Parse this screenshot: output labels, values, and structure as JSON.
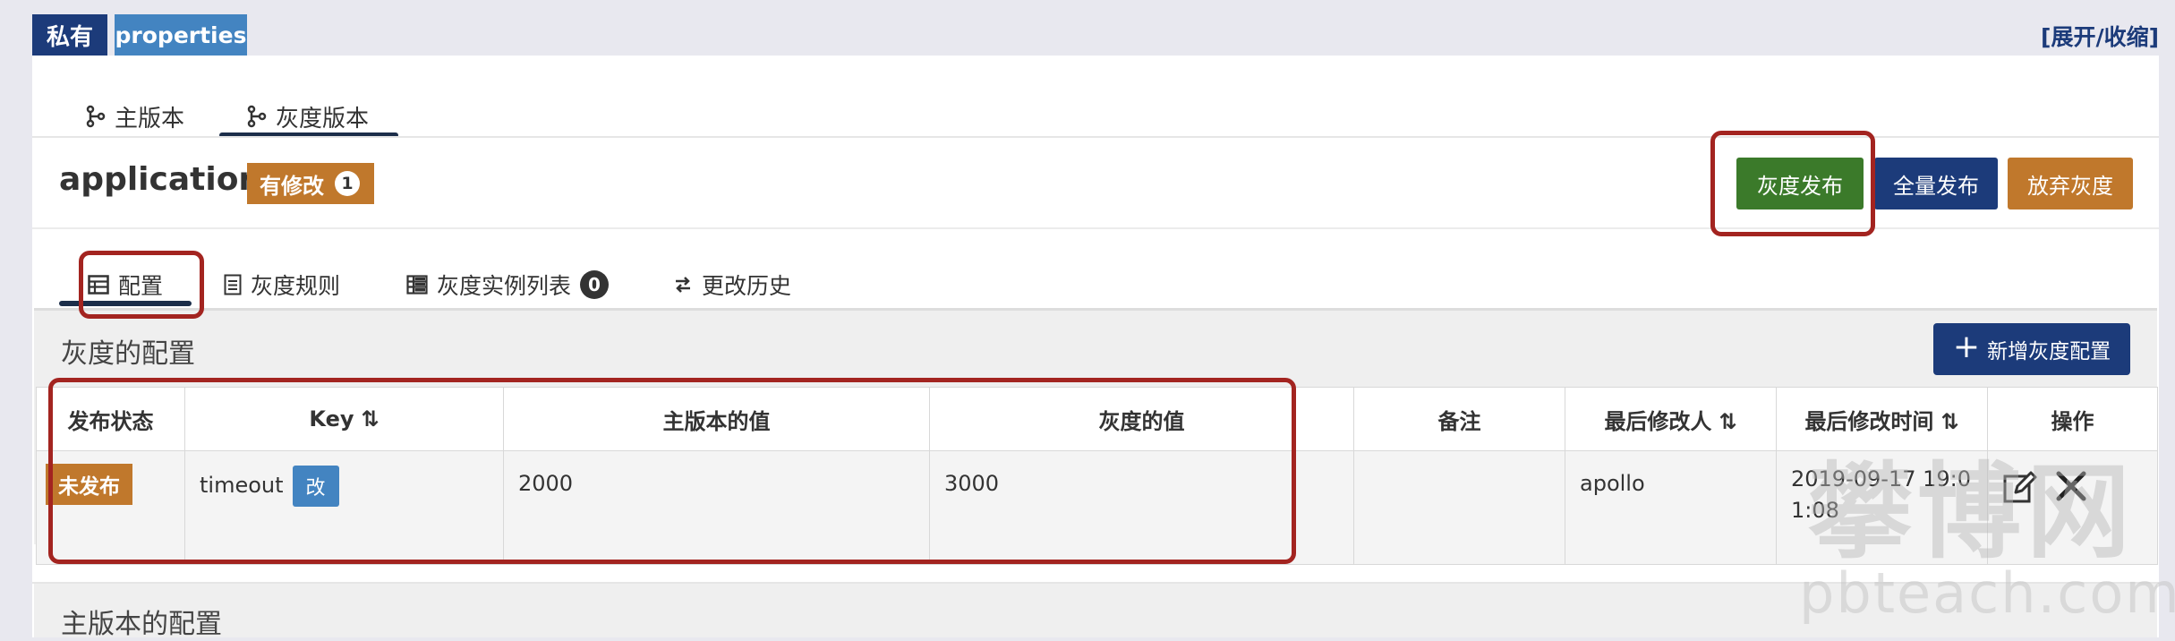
{
  "labels": {
    "private": "私有",
    "type": "properties"
  },
  "expand_link": "[展开/收缩]",
  "branch_tabs": [
    {
      "label": "主版本",
      "icon": "git-branch-icon"
    },
    {
      "label": "灰度版本",
      "icon": "git-branch-icon",
      "active": true
    }
  ],
  "namespace": {
    "name": "application",
    "modified_label": "有修改",
    "modified_count": "1"
  },
  "actions": {
    "gray_publish": "灰度发布",
    "full_publish": "全量发布",
    "abandon_gray": "放弃灰度"
  },
  "sub_tabs": {
    "config": "配置",
    "rules": "灰度规则",
    "instances": "灰度实例列表",
    "instances_count": "0",
    "history": "更改历史"
  },
  "gray_section": {
    "title": "灰度的配置",
    "add_button": "新增灰度配置",
    "columns": [
      "发布状态",
      "Key",
      "主版本的值",
      "灰度的值",
      "备注",
      "最后修改人",
      "最后修改时间",
      "操作"
    ],
    "sort_glyph": "⇅",
    "rows": [
      {
        "status": "未发布",
        "key": "timeout",
        "key_tag": "改",
        "master_value": "2000",
        "gray_value": "3000",
        "comment": "",
        "modifier": "apollo",
        "modified_time": "2019-09-17 19:01:08"
      }
    ]
  },
  "master_section": {
    "title": "主版本的配置"
  },
  "watermark": {
    "cn": "攀博网",
    "en": "pbteach.com"
  },
  "colors": {
    "navy": "#1c3b7a",
    "blue": "#4384c1",
    "green": "#3b7a2a",
    "orange": "#c0782c",
    "annotation_red": "#a32420"
  }
}
